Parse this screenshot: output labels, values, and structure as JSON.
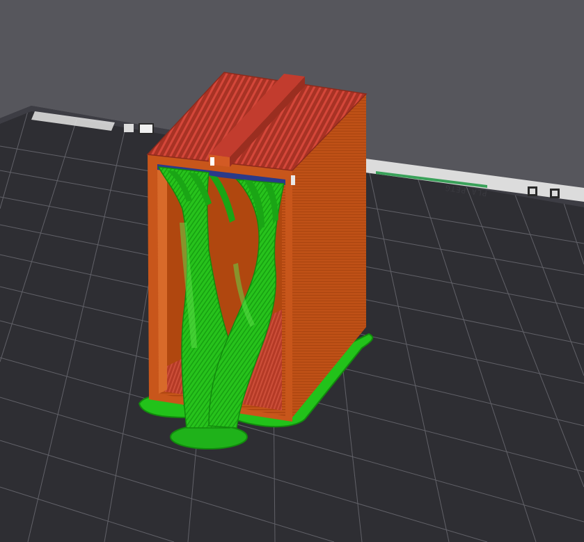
{
  "viewport": {
    "background": "#56565c",
    "bed_color": "#2e2e33",
    "grid_color": "#6b6b72",
    "bed_label_text": "PLA PETG",
    "bed_label_icon": "qr-marker-icon"
  },
  "model": {
    "wall_color": "#c8561b",
    "top_infill_color": "#b83a2c",
    "support_color": "#22c21a",
    "support_dark_color": "#159a10"
  }
}
